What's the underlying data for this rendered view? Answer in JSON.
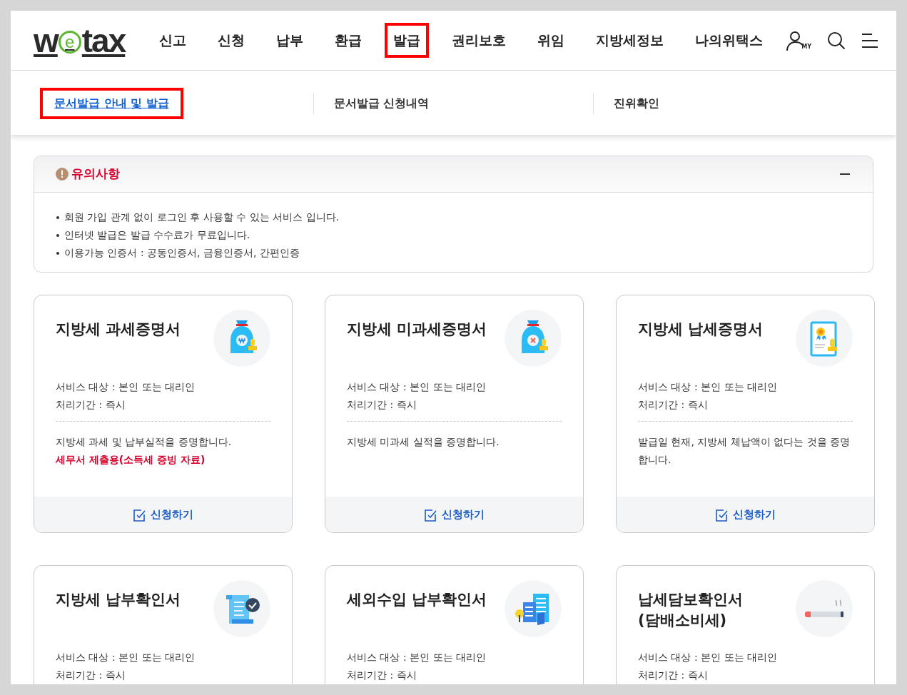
{
  "header": {
    "logo": {
      "before": "w",
      "mark": "e",
      "after": "tax"
    },
    "nav": [
      {
        "label": "신고",
        "highlighted": false
      },
      {
        "label": "신청",
        "highlighted": false
      },
      {
        "label": "납부",
        "highlighted": false
      },
      {
        "label": "환급",
        "highlighted": false
      },
      {
        "label": "발급",
        "highlighted": true
      },
      {
        "label": "권리보호",
        "highlighted": false
      },
      {
        "label": "위임",
        "highlighted": false
      },
      {
        "label": "지방세정보",
        "highlighted": false
      },
      {
        "label": "나의위택스",
        "highlighted": false
      }
    ],
    "my_label": "MY"
  },
  "submenu": [
    {
      "label": "문서발급 안내 및 발급",
      "selected": true,
      "highlighted": true
    },
    {
      "label": "문서발급 신청내역",
      "selected": false,
      "highlighted": false
    },
    {
      "label": "진위확인",
      "selected": false,
      "highlighted": false
    }
  ],
  "notice": {
    "title": "유의사항",
    "expanded": true,
    "items": [
      "회원 가입 관계 없이 로그인 후 사용할 수 있는 서비스 입니다.",
      "인터넷 발급은 발급 수수료가 무료입니다.",
      "이용가능 인증서 : 공동인증서, 금융인증서, 간편인증"
    ]
  },
  "cards": [
    {
      "title_lines": [
        "지방세 과세증명서"
      ],
      "kind": "bag-won",
      "info": [
        "서비스 대상 : 본인 또는 대리인",
        "처리기간 : 즉시"
      ],
      "description": "지방세 과세 및 납부실적을 증명합니다.",
      "note": "세무서 제출용(소득세 증빙 자료)",
      "action": "신청하기"
    },
    {
      "title_lines": [
        "지방세 미과세증명서"
      ],
      "kind": "bag-x",
      "info": [
        "서비스 대상 : 본인 또는 대리인",
        "처리기간 : 즉시"
      ],
      "description": "지방세 미과세 실적을 증명합니다.",
      "action": "신청하기"
    },
    {
      "title_lines": [
        "지방세 납세증명서"
      ],
      "kind": "certificate",
      "info": [
        "서비스 대상 : 본인 또는 대리인",
        "처리기간 : 즉시"
      ],
      "description": "발급일 현재, 지방세 체납액이 없다는 것을 증명합니다.",
      "action": "신청하기"
    },
    {
      "title_lines": [
        "지방세 납부확인서"
      ],
      "kind": "scroll",
      "info": [
        "서비스 대상 : 본인 또는 대리인",
        "처리기간 : 즉시"
      ]
    },
    {
      "title_lines": [
        "세외수입 납부확인서"
      ],
      "kind": "buildings",
      "info": [
        "서비스 대상 : 본인 또는 대리인",
        "처리기간 : 즉시"
      ]
    },
    {
      "title_lines": [
        "납세담보확인서",
        "(담배소비세)"
      ],
      "kind": "cigarette",
      "info": [
        "서비스 대상 : 본인 또는 대리인",
        "처리기간 : 즉시"
      ]
    }
  ]
}
